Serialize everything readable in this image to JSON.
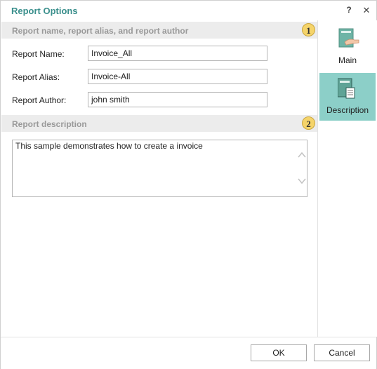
{
  "window": {
    "title": "Report Options",
    "help_label": "?",
    "close_label": "✕"
  },
  "sections": {
    "main_header": "Report name, report alias, and report author",
    "main_badge": "1",
    "description_header": "Report description",
    "description_badge": "2"
  },
  "fields": {
    "name_label": "Report Name:",
    "name_value": "Invoice_All",
    "alias_label": "Report Alias:",
    "alias_value": "Invoice-All",
    "author_label": "Report Author:",
    "author_value": "john smith"
  },
  "description": {
    "text": "This sample demonstrates how to create a invoice"
  },
  "sidebar": {
    "items": [
      {
        "label": "Main",
        "icon": "hand-document-icon",
        "active": false
      },
      {
        "label": "Description",
        "icon": "document-page-icon",
        "active": true
      }
    ]
  },
  "footer": {
    "ok_label": "OK",
    "cancel_label": "Cancel"
  },
  "colors": {
    "title": "#3a8f8c",
    "active_nav": "#8ccfc8",
    "badge": "#f5d46a"
  }
}
